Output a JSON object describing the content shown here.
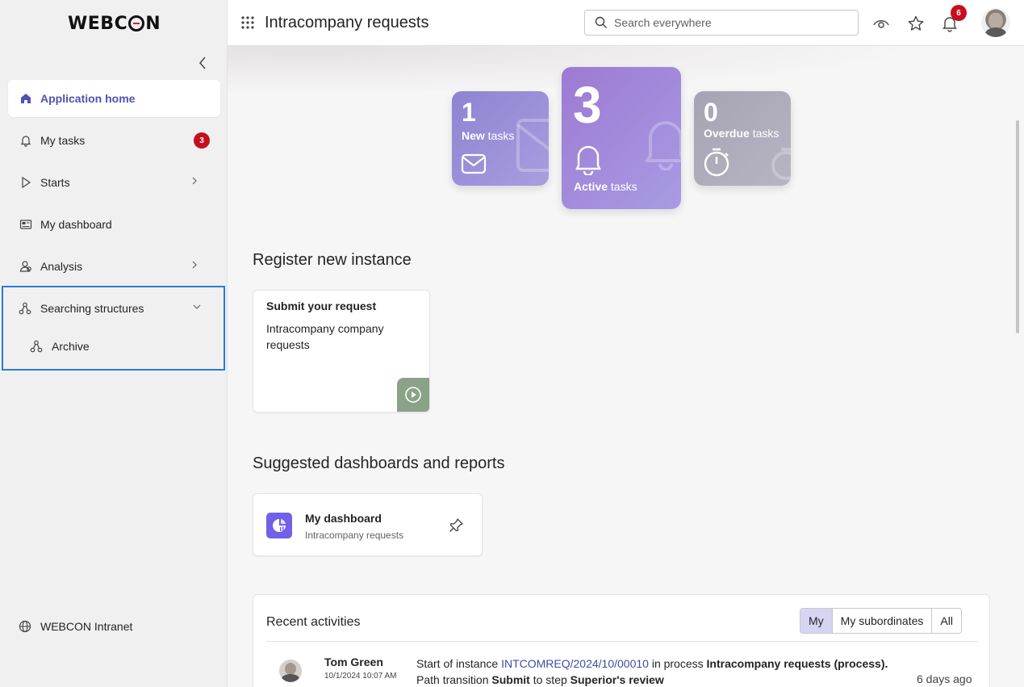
{
  "app": {
    "logo": "WEBCON",
    "title": "Intracompany requests"
  },
  "search": {
    "placeholder": "Search everywhere"
  },
  "header": {
    "notifications_count": "6"
  },
  "sidebar": {
    "items": [
      {
        "label": "Application home",
        "icon": "home-icon",
        "active": true
      },
      {
        "label": "My tasks",
        "icon": "bell-icon",
        "badge": "3"
      },
      {
        "label": "Starts",
        "icon": "play-icon"
      },
      {
        "label": "My dashboard",
        "icon": "dashboard-icon"
      },
      {
        "label": "Analysis",
        "icon": "analysis-icon"
      }
    ],
    "searching_structures": {
      "label": "Searching structures",
      "child": "Archive"
    },
    "footer_link": "WEBCON Intranet"
  },
  "tiles": {
    "new": {
      "count": "1",
      "bold": "New",
      "rest": " tasks"
    },
    "active": {
      "count": "3",
      "bold": "Active",
      "rest": " tasks"
    },
    "overdue": {
      "count": "0",
      "bold": "Overdue",
      "rest": " tasks"
    }
  },
  "register": {
    "heading": "Register new instance",
    "card_title": "Submit your request",
    "card_desc": "Intracompany company requests"
  },
  "suggested": {
    "heading": "Suggested dashboards and reports",
    "title": "My dashboard",
    "subtitle": "Intracompany requests"
  },
  "recent": {
    "heading": "Recent activities",
    "filters": [
      "My",
      "My subordinates",
      "All"
    ],
    "activity": {
      "user": "Tom Green",
      "timestamp": "10/1/2024 10:07 AM",
      "line1_pre": "Start of instance ",
      "instance": "INTCOMREQ/2024/10/00010",
      "line1_mid": " in process ",
      "process": "Intracompany requests (process).",
      "line2_pre": "Path transition ",
      "path": "Submit",
      "line2_mid": " to step ",
      "step": "Superior's review",
      "ago": "6 days ago"
    }
  },
  "colors": {
    "accent": "#4f52b2",
    "badge": "#c50f1f",
    "highlight_border": "#2b7cd3"
  }
}
